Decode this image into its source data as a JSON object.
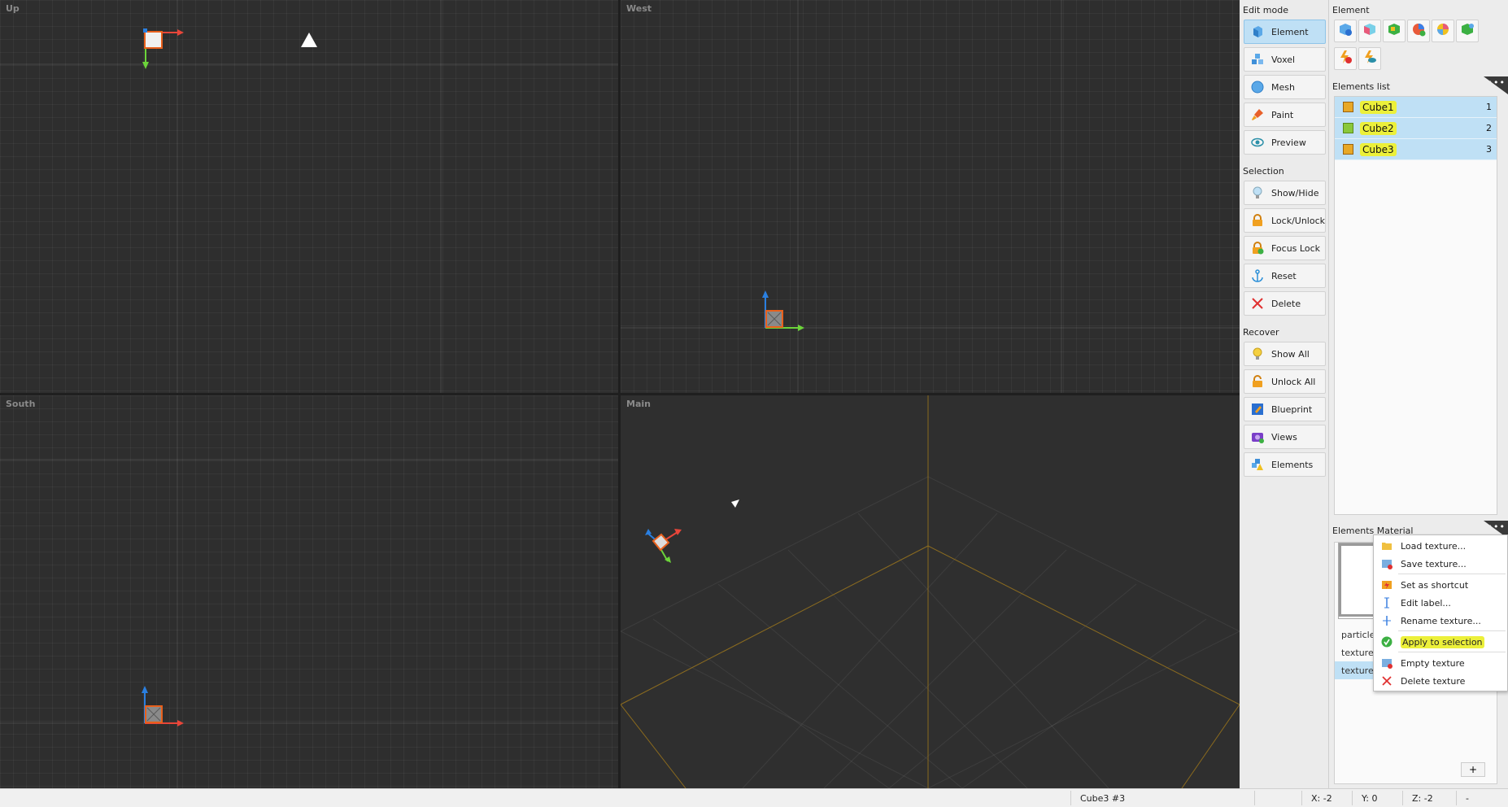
{
  "viewports": {
    "up": {
      "title": "Up"
    },
    "west": {
      "title": "West"
    },
    "south": {
      "title": "South"
    },
    "main": {
      "title": "Main"
    }
  },
  "edit_mode": {
    "title": "Edit mode",
    "buttons": [
      {
        "label": "Element",
        "icon": "element-cube-icon",
        "active": true
      },
      {
        "label": "Voxel",
        "icon": "voxel-icon",
        "active": false
      },
      {
        "label": "Mesh",
        "icon": "mesh-sphere-icon",
        "active": false
      },
      {
        "label": "Paint",
        "icon": "paint-brush-icon",
        "active": false
      },
      {
        "label": "Preview",
        "icon": "eye-icon",
        "active": false
      }
    ]
  },
  "selection": {
    "title": "Selection",
    "buttons": [
      {
        "label": "Show/Hide",
        "icon": "bulb-icon"
      },
      {
        "label": "Lock/Unlock",
        "icon": "lock-icon"
      },
      {
        "label": "Focus Lock",
        "icon": "focus-lock-icon"
      },
      {
        "label": "Reset",
        "icon": "anchor-icon"
      },
      {
        "label": "Delete",
        "icon": "delete-x-icon"
      }
    ]
  },
  "recover": {
    "title": "Recover",
    "buttons": [
      {
        "label": "Show All",
        "icon": "bulb-icon"
      },
      {
        "label": "Unlock All",
        "icon": "unlock-icon"
      },
      {
        "label": "Blueprint",
        "icon": "blueprint-icon"
      },
      {
        "label": "Views",
        "icon": "camera-icon"
      },
      {
        "label": "Elements",
        "icon": "elements-warning-icon"
      }
    ]
  },
  "element": {
    "title": "Element",
    "tools": [
      "add-element-icon",
      "add-cube-icon",
      "add-textured-cube-icon",
      "color-wheel-check-icon",
      "color-wheel-icon",
      "cube-check-icon",
      "flash-delete-icon",
      "flash-eye-icon"
    ]
  },
  "elements_list": {
    "title": "Elements list",
    "menu_glyph": "•••",
    "items": [
      {
        "name": "Cube1",
        "index": "1"
      },
      {
        "name": "Cube2",
        "index": "2"
      },
      {
        "name": "Cube3",
        "index": "3"
      }
    ]
  },
  "elements_material": {
    "title": "Elements Material",
    "menu_glyph": "•••",
    "rows": [
      {
        "label": "particle",
        "selected": false
      },
      {
        "label": "texture",
        "selected": false
      },
      {
        "label": "texture",
        "selected": true
      }
    ],
    "add_label": "+"
  },
  "context_menu": {
    "items": [
      {
        "label": "Load texture...",
        "icon": "folder-icon",
        "highlight": false
      },
      {
        "label": "Save texture...",
        "icon": "save-image-icon",
        "highlight": false
      },
      {
        "label": "Set as shortcut",
        "icon": "shortcut-icon",
        "highlight": false
      },
      {
        "label": "Edit label...",
        "icon": "edit-text-icon",
        "highlight": false
      },
      {
        "label": "Rename texture...",
        "icon": "rename-icon",
        "highlight": false
      },
      {
        "label": "Apply to selection",
        "icon": "check-circle-icon",
        "highlight": true
      },
      {
        "label": "Empty texture",
        "icon": "empty-image-icon",
        "highlight": false
      },
      {
        "label": "Delete texture",
        "icon": "delete-x-icon",
        "highlight": false
      }
    ]
  },
  "status": {
    "selection": "Cube3 #3",
    "x": "X: -2",
    "y": "Y: 0",
    "z": "Z: -2",
    "extra": "-"
  },
  "colors": {
    "selection": "#bfe0f5",
    "highlight": "#ecf03a",
    "axis_x": "#e8463a",
    "axis_y": "#6cd43a",
    "axis_z": "#2a7fe0",
    "cube_outline": "#e8601c"
  }
}
